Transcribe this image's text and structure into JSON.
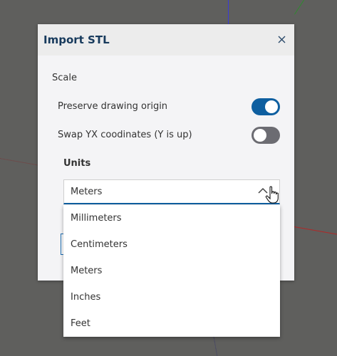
{
  "dialog": {
    "title": "Import STL",
    "close_icon": "close-icon"
  },
  "scale": {
    "label": "Scale",
    "preserve_origin": {
      "label": "Preserve drawing origin",
      "enabled": true
    },
    "swap_yx": {
      "label": "Swap YX coodinates (Y is up)",
      "enabled": false
    }
  },
  "units": {
    "label": "Units",
    "selected": "Meters",
    "options": [
      "Millimeters",
      "Centimeters",
      "Meters",
      "Inches",
      "Feet"
    ]
  },
  "colors": {
    "accent": "#0e5fa0",
    "toggle_off": "#6c6c72",
    "title": "#173a5c"
  }
}
